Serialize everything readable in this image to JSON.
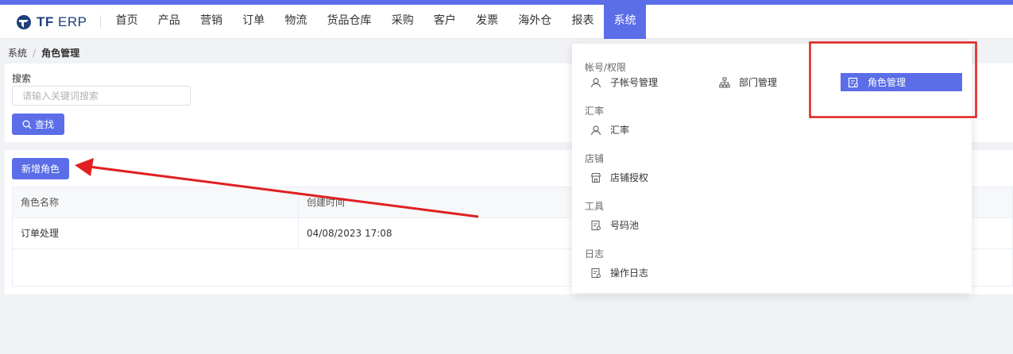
{
  "app": {
    "logo_bold": "TF",
    "logo_rest": " ERP"
  },
  "nav": {
    "items": [
      {
        "label": "首页",
        "active": false
      },
      {
        "label": "产品",
        "active": false
      },
      {
        "label": "营销",
        "active": false
      },
      {
        "label": "订单",
        "active": false
      },
      {
        "label": "物流",
        "active": false
      },
      {
        "label": "货品仓库",
        "active": false
      },
      {
        "label": "采购",
        "active": false
      },
      {
        "label": "客户",
        "active": false
      },
      {
        "label": "发票",
        "active": false
      },
      {
        "label": "海外仓",
        "active": false
      },
      {
        "label": "报表",
        "active": false
      },
      {
        "label": "系统",
        "active": true
      }
    ]
  },
  "breadcrumb": {
    "parent": "系统",
    "separator": "/",
    "current": "角色管理"
  },
  "search": {
    "label": "搜索",
    "value": "",
    "placeholder": "请输入关键词搜索",
    "button_label": "查找"
  },
  "table": {
    "add_button_label": "新增角色",
    "columns": [
      "角色名称",
      "创建时间"
    ],
    "rows": [
      [
        "订单处理",
        "04/08/2023 17:08"
      ]
    ]
  },
  "dropdown": {
    "groups": [
      {
        "title": "帐号/权限",
        "items": [
          {
            "label": "子帐号管理",
            "icon": "user-icon",
            "active": false
          },
          {
            "label": "部门管理",
            "icon": "org-chart-icon",
            "active": false
          },
          {
            "label": "角色管理",
            "icon": "role-icon",
            "active": true
          }
        ]
      },
      {
        "title": "汇率",
        "items": [
          {
            "label": "汇率",
            "icon": "user-icon",
            "active": false
          }
        ]
      },
      {
        "title": "店铺",
        "items": [
          {
            "label": "店铺授权",
            "icon": "store-icon",
            "active": false
          }
        ]
      },
      {
        "title": "工具",
        "items": [
          {
            "label": "号码池",
            "icon": "document-icon",
            "active": false
          }
        ]
      },
      {
        "title": "日志",
        "items": [
          {
            "label": "操作日志",
            "icon": "document-icon",
            "active": false
          }
        ]
      }
    ]
  },
  "colors": {
    "primary": "#5b6ee8",
    "annotation_red": "#e02020",
    "page_bg": "#f0f2f5"
  }
}
